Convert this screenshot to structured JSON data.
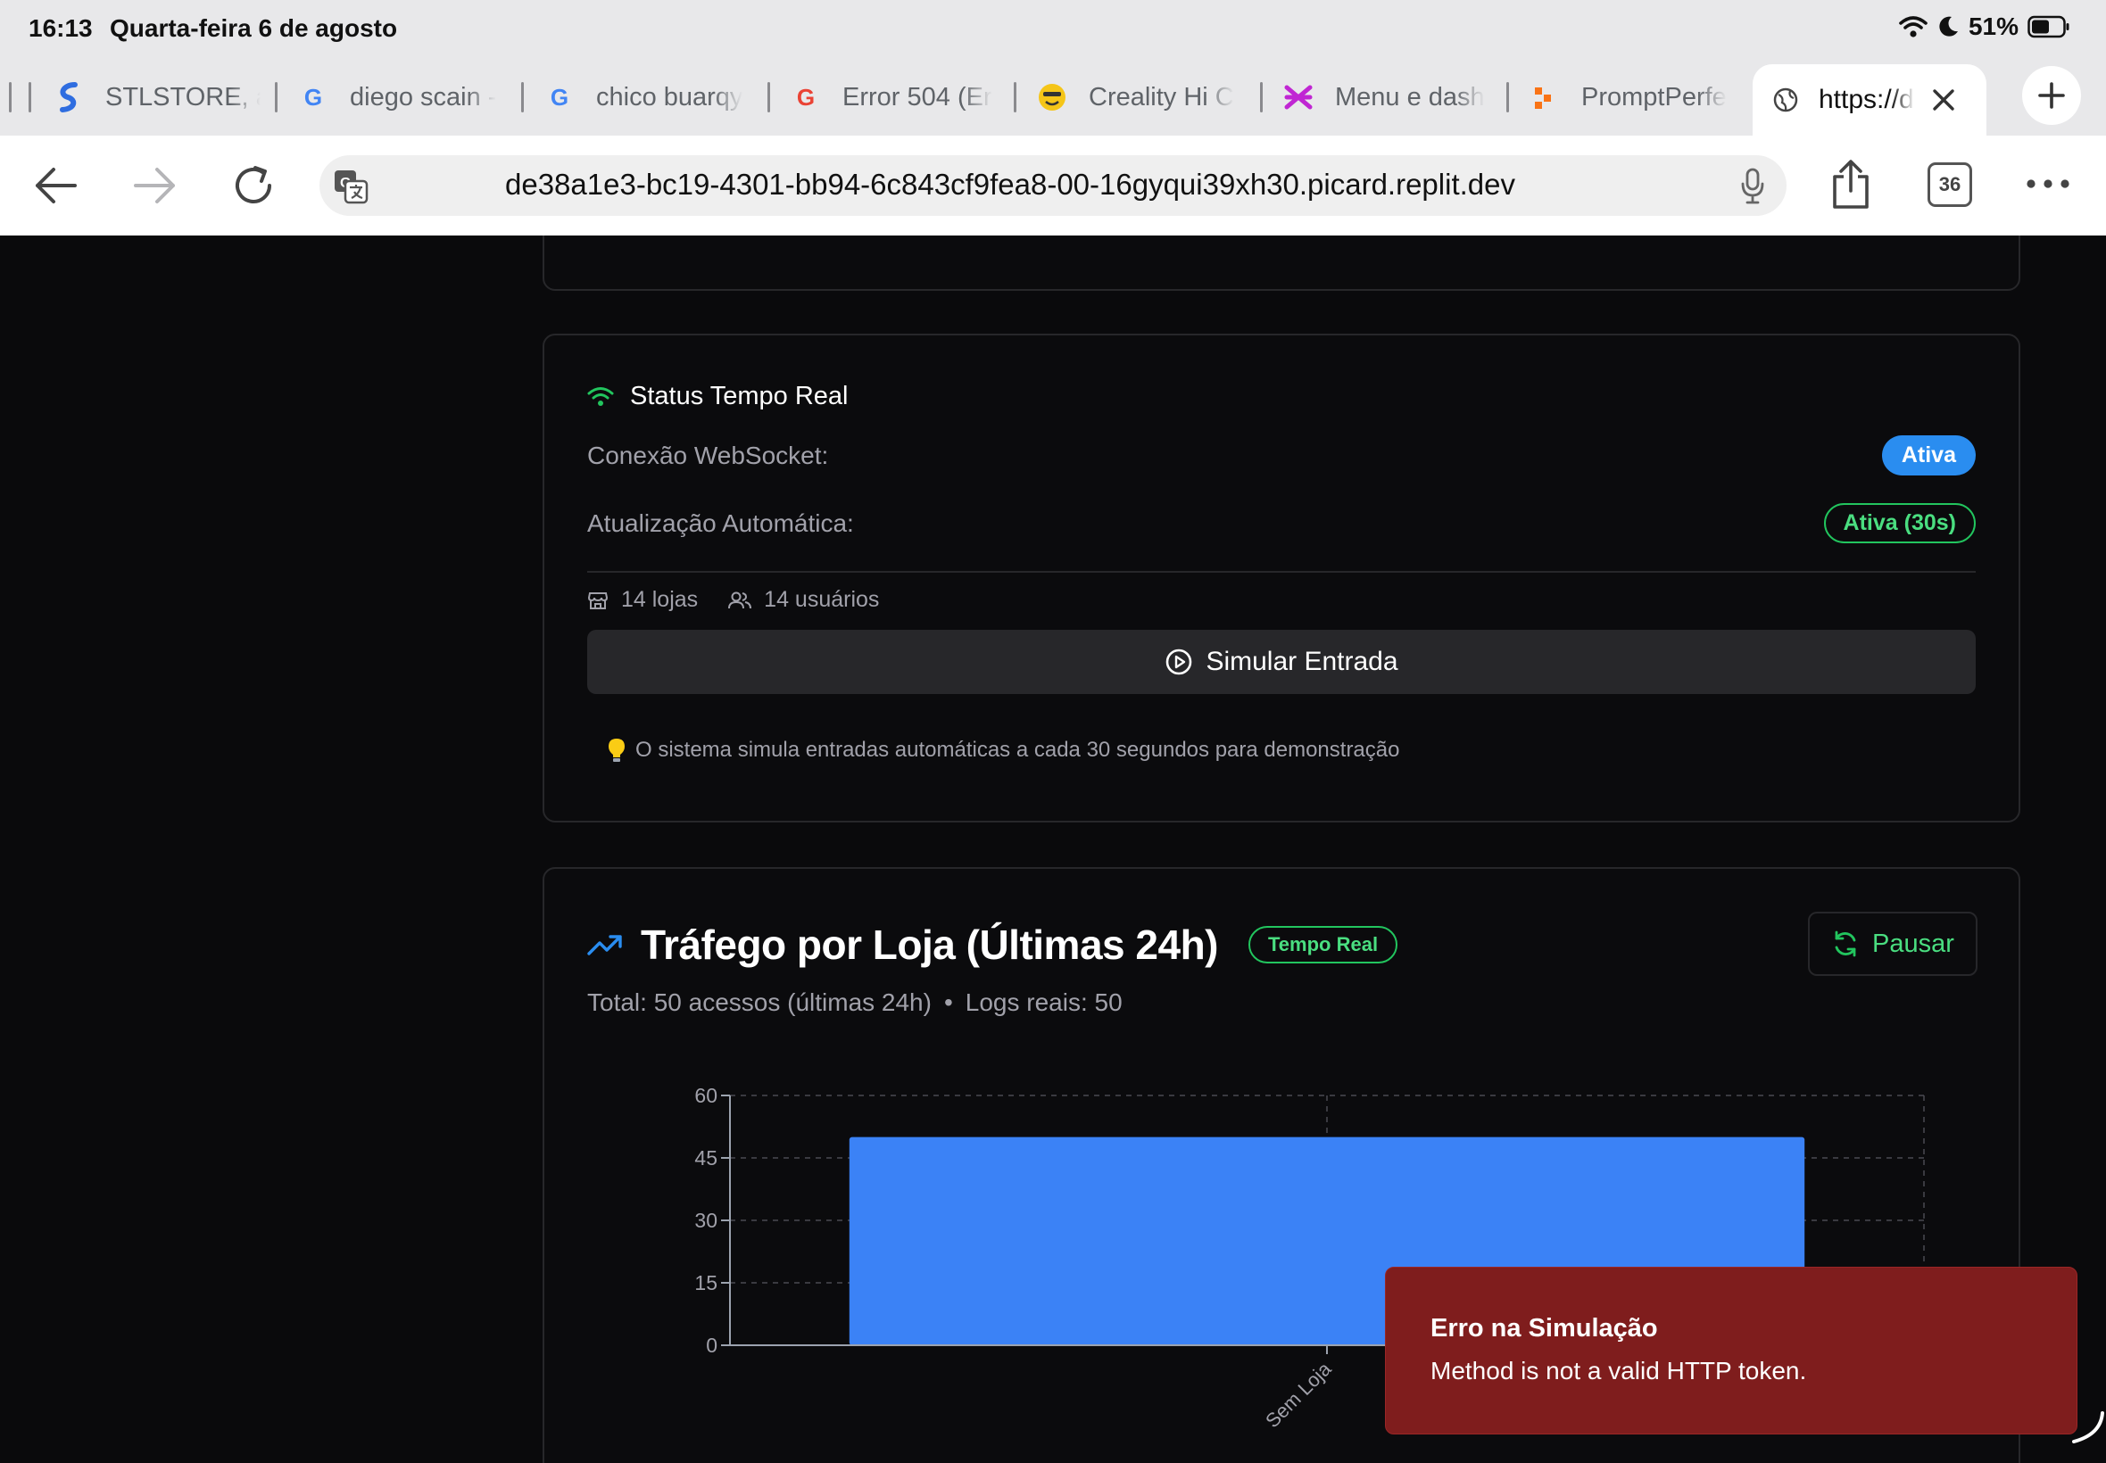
{
  "statusbar": {
    "time": "16:13",
    "date": "Quarta-feira 6 de agosto",
    "battery": "51%"
  },
  "tabs": [
    {
      "label": "STLSTORE, a",
      "icon": "stlstore-logo-icon"
    },
    {
      "label": "diego scain -",
      "icon": "google-icon"
    },
    {
      "label": "chico buarqy",
      "icon": "google-icon"
    },
    {
      "label": "Error 504 (Er",
      "icon": "google-icon"
    },
    {
      "label": "Creality Hi C",
      "icon": "smiley-icon"
    },
    {
      "label": "Menu e dash",
      "icon": "figma-icon"
    },
    {
      "label": "PromptPerfe",
      "icon": "promptperfect-icon"
    }
  ],
  "active_tab": {
    "label": "https://de"
  },
  "toolbar": {
    "url": "de38a1e3-bc19-4301-bb94-6c843cf9fea8-00-16gyqui39xh30.picard.replit.dev",
    "tab_count": "36"
  },
  "status_card": {
    "title": "Status Tempo Real",
    "websocket_label": "Conexão WebSocket:",
    "websocket_value": "Ativa",
    "auto_update_label": "Atualização Automática:",
    "auto_update_value": "Ativa (30s)",
    "stores": "14 lojas",
    "users": "14 usuários",
    "simulate_button": "Simular Entrada",
    "note": "O sistema simula entradas automáticas a cada 30 segundos para demonstração"
  },
  "traffic_card": {
    "title": "Tráfego por Loja (Últimas 24h)",
    "badge": "Tempo Real",
    "pause_button": "Pausar",
    "summary_total": "Total: 50 acessos (últimas 24h)",
    "summary_sep": "•",
    "summary_logs": "Logs reais: 50"
  },
  "colors": {
    "bar": "#3b82f6",
    "accent_blue": "#2a8df0",
    "accent_green": "#22c55e",
    "toast_bg": "#7f1d1d"
  },
  "chart_data": {
    "type": "bar",
    "categories": [
      "Sem Loja"
    ],
    "values": [
      50
    ],
    "ylim": [
      0,
      60
    ],
    "yticks": [
      "0",
      "15",
      "30",
      "45",
      "60"
    ],
    "grid": true
  },
  "toast": {
    "title": "Erro na Simulação",
    "message": "Method is not a valid HTTP token."
  }
}
